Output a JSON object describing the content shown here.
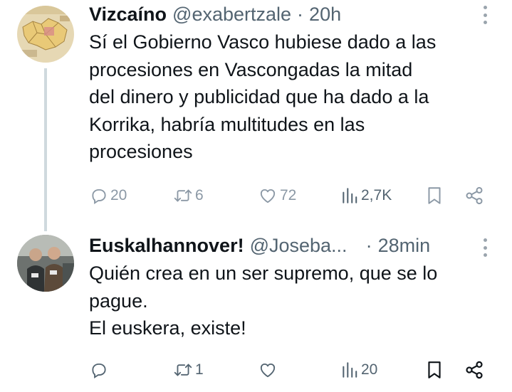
{
  "tweets": [
    {
      "author": {
        "name": "Vizcaíno",
        "handle": "@exabertzale",
        "separator": "·",
        "time": "20h"
      },
      "text": "Sí el Gobierno Vasco hubiese dado a las\nprocesiones en Vascongadas la mitad\ndel dinero y publicidad que ha dado a la\nKorrika, habría multitudes en las\nprocesiones",
      "stats": {
        "replies": "20",
        "retweets": "6",
        "likes": "72",
        "views": "2,7K"
      }
    },
    {
      "author": {
        "name": "Euskalhannover!",
        "handle": "@Joseba...",
        "separator": "·",
        "time": "28min"
      },
      "text": "Quién crea en un ser supremo, que se lo\npague.\nEl euskera, existe!",
      "stats": {
        "replies": "",
        "retweets": "1",
        "likes": "",
        "views": "20"
      }
    }
  ],
  "icons": {
    "reply": "reply-icon",
    "retweet": "retweet-icon",
    "like": "heart-icon",
    "views": "views-icon",
    "bookmark": "bookmark-icon",
    "share": "share-icon",
    "more": "more-options-icon"
  },
  "colors": {
    "text": "#0f1419",
    "secondary": "#536471",
    "muted_action": "#8b98a5",
    "thread_line": "#cfd9de"
  }
}
